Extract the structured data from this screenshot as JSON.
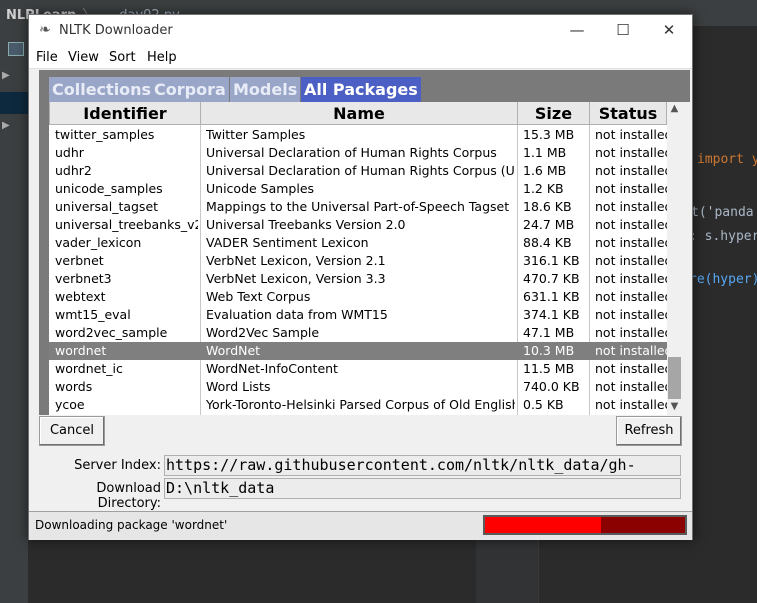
{
  "ide": {
    "project": "NLPLearn",
    "file": "day02.py",
    "code_lines": [
      {
        "parts": [
          {
            "t": "import y",
            "c": "kw"
          }
        ]
      },
      {
        "parts": [
          {
            "t": "t('panda",
            "c": ""
          }
        ]
      },
      {
        "parts": [
          {
            "t": ": s.hyper",
            "c": ""
          }
        ]
      },
      {
        "parts": [
          {
            "t": "re(hyper)",
            "c": "fn"
          }
        ]
      }
    ]
  },
  "dialog": {
    "title": "NLTK Downloader",
    "window_buttons": {
      "minimize": "—",
      "maximize": "☐",
      "close": "✕"
    },
    "menu": [
      "File",
      "View",
      "Sort",
      "Help"
    ],
    "tabs": [
      {
        "label": "Collections",
        "active": false
      },
      {
        "label": "Corpora",
        "active": false
      },
      {
        "label": "Models",
        "active": false
      },
      {
        "label": "All Packages",
        "active": true
      }
    ],
    "columns": [
      "Identifier",
      "Name",
      "Size",
      "Status"
    ],
    "rows": [
      {
        "id": "twitter_samples",
        "name": "Twitter Samples",
        "size": "15.3 MB",
        "status": "not installed"
      },
      {
        "id": "udhr",
        "name": "Universal Declaration of Human Rights Corpus",
        "size": "1.1 MB",
        "status": "not installed"
      },
      {
        "id": "udhr2",
        "name": "Universal Declaration of Human Rights Corpus (Unico",
        "size": "1.6 MB",
        "status": "not installed"
      },
      {
        "id": "unicode_samples",
        "name": "Unicode Samples",
        "size": "1.2 KB",
        "status": "not installed"
      },
      {
        "id": "universal_tagset",
        "name": "Mappings to the Universal Part-of-Speech Tagset",
        "size": "18.6 KB",
        "status": "not installed"
      },
      {
        "id": "universal_treebanks_v2",
        "name": "Universal Treebanks Version 2.0",
        "size": "24.7 MB",
        "status": "not installed"
      },
      {
        "id": "vader_lexicon",
        "name": "VADER Sentiment Lexicon",
        "size": "88.4 KB",
        "status": "not installed"
      },
      {
        "id": "verbnet",
        "name": "VerbNet Lexicon, Version 2.1",
        "size": "316.1 KB",
        "status": "not installed"
      },
      {
        "id": "verbnet3",
        "name": "VerbNet Lexicon, Version 3.3",
        "size": "470.7 KB",
        "status": "not installed"
      },
      {
        "id": "webtext",
        "name": "Web Text Corpus",
        "size": "631.1 KB",
        "status": "not installed"
      },
      {
        "id": "wmt15_eval",
        "name": "Evaluation data from WMT15",
        "size": "374.1 KB",
        "status": "not installed"
      },
      {
        "id": "word2vec_sample",
        "name": "Word2Vec Sample",
        "size": "47.1 MB",
        "status": "not installed"
      },
      {
        "id": "wordnet",
        "name": "WordNet",
        "size": "10.3 MB",
        "status": "not installed",
        "selected": true
      },
      {
        "id": "wordnet_ic",
        "name": "WordNet-InfoContent",
        "size": "11.5 MB",
        "status": "not installed"
      },
      {
        "id": "words",
        "name": "Word Lists",
        "size": "740.0 KB",
        "status": "not installed"
      },
      {
        "id": "ycoe",
        "name": "York-Toronto-Helsinki Parsed Corpus of Old English",
        "size": "0.5 KB",
        "status": "not installed"
      }
    ],
    "cancel_label": "Cancel",
    "refresh_label": "Refresh",
    "server_index_label": "Server Index:",
    "server_index_value": "https://raw.githubusercontent.com/nltk/nltk_data/gh-",
    "download_dir_label": "Download Directory:",
    "download_dir_value": "D:\\nltk_data",
    "status_text": "Downloading package 'wordnet'",
    "progress_fraction": 0.58,
    "colors": {
      "progress_fill": "#ff0000",
      "progress_track": "#8b0000",
      "tab_active": "#4b5fc4",
      "tab_inactive": "#9aa6c8"
    }
  }
}
